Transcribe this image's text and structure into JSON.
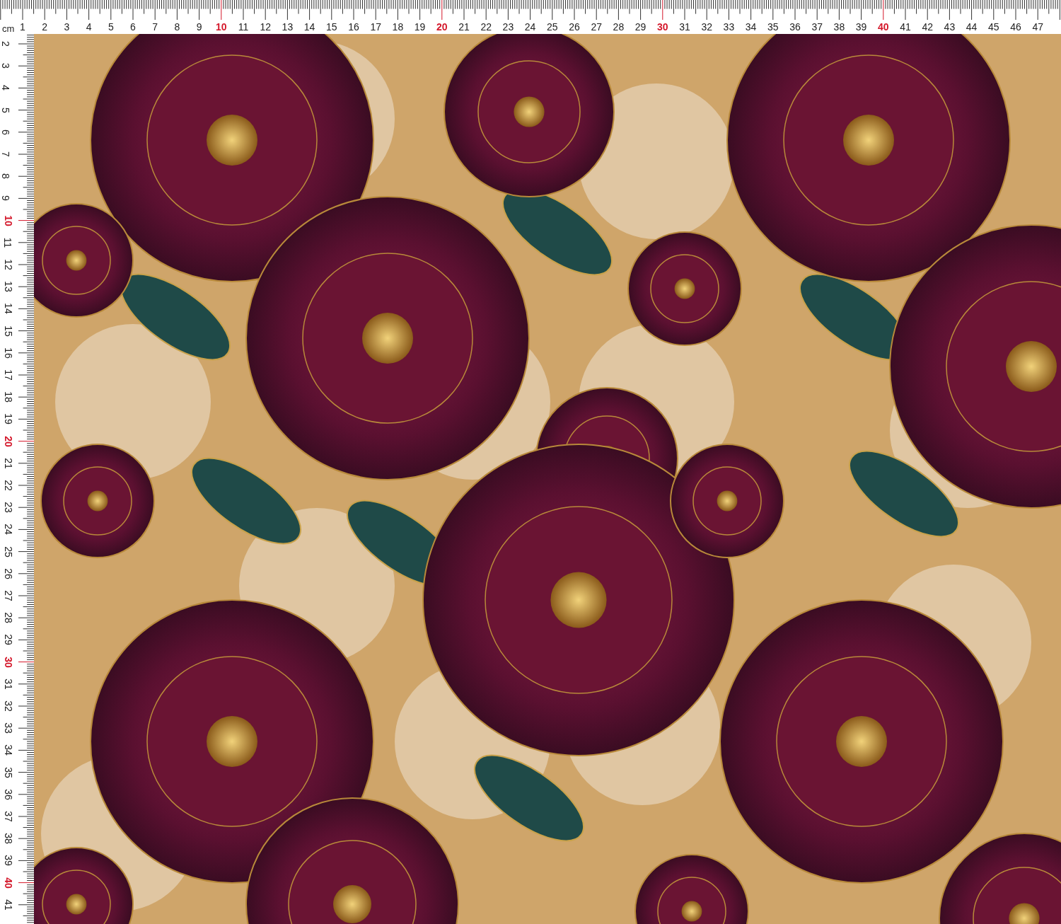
{
  "top_ruler": {
    "unit": "cm",
    "labels": [
      {
        "text": "1",
        "highlighted": false
      },
      {
        "text": "2",
        "highlighted": false
      },
      {
        "text": "3",
        "highlighted": false
      },
      {
        "text": "4",
        "highlighted": false
      },
      {
        "text": "5",
        "highlighted": false
      },
      {
        "text": "6",
        "highlighted": false
      },
      {
        "text": "7",
        "highlighted": false
      },
      {
        "text": "8",
        "highlighted": false
      },
      {
        "text": "9",
        "highlighted": false
      },
      {
        "text": "10",
        "highlighted": true
      },
      {
        "text": "11",
        "highlighted": false
      },
      {
        "text": "12",
        "highlighted": false
      },
      {
        "text": "13",
        "highlighted": false
      },
      {
        "text": "14",
        "highlighted": false
      },
      {
        "text": "15",
        "highlighted": false
      },
      {
        "text": "16",
        "highlighted": false
      },
      {
        "text": "17",
        "highlighted": false
      },
      {
        "text": "18",
        "highlighted": false
      },
      {
        "text": "19",
        "highlighted": false
      },
      {
        "text": "20",
        "highlighted": true
      },
      {
        "text": "21",
        "highlighted": false
      },
      {
        "text": "22",
        "highlighted": false
      },
      {
        "text": "23",
        "highlighted": false
      },
      {
        "text": "24",
        "highlighted": false
      },
      {
        "text": "25",
        "highlighted": false
      },
      {
        "text": "26",
        "highlighted": false
      },
      {
        "text": "27",
        "highlighted": false
      },
      {
        "text": "28",
        "highlighted": false
      },
      {
        "text": "29",
        "highlighted": false
      },
      {
        "text": "30",
        "highlighted": true
      },
      {
        "text": "31",
        "highlighted": false
      },
      {
        "text": "32",
        "highlighted": false
      },
      {
        "text": "33",
        "highlighted": false
      },
      {
        "text": "34",
        "highlighted": false
      },
      {
        "text": "35",
        "highlighted": false
      },
      {
        "text": "36",
        "highlighted": false
      },
      {
        "text": "37",
        "highlighted": false
      },
      {
        "text": "38",
        "highlighted": false
      },
      {
        "text": "39",
        "highlighted": false
      },
      {
        "text": "40",
        "highlighted": true
      },
      {
        "text": "41",
        "highlighted": false
      },
      {
        "text": "42",
        "highlighted": false
      },
      {
        "text": "43",
        "highlighted": false
      },
      {
        "text": "44",
        "highlighted": false
      },
      {
        "text": "45",
        "highlighted": false
      },
      {
        "text": "46",
        "highlighted": false
      },
      {
        "text": "47",
        "highlighted": false
      }
    ]
  },
  "left_ruler": {
    "labels": [
      {
        "text": "2",
        "highlighted": false
      },
      {
        "text": "3",
        "highlighted": false
      },
      {
        "text": "4",
        "highlighted": false
      },
      {
        "text": "5",
        "highlighted": false
      },
      {
        "text": "6",
        "highlighted": false
      },
      {
        "text": "7",
        "highlighted": false
      },
      {
        "text": "8",
        "highlighted": false
      },
      {
        "text": "9",
        "highlighted": false
      },
      {
        "text": "10",
        "highlighted": true
      },
      {
        "text": "11",
        "highlighted": false
      },
      {
        "text": "12",
        "highlighted": false
      },
      {
        "text": "13",
        "highlighted": false
      },
      {
        "text": "14",
        "highlighted": false
      },
      {
        "text": "15",
        "highlighted": false
      },
      {
        "text": "16",
        "highlighted": false
      },
      {
        "text": "17",
        "highlighted": false
      },
      {
        "text": "18",
        "highlighted": false
      },
      {
        "text": "19",
        "highlighted": false
      },
      {
        "text": "20",
        "highlighted": true
      },
      {
        "text": "21",
        "highlighted": false
      },
      {
        "text": "22",
        "highlighted": false
      },
      {
        "text": "23",
        "highlighted": false
      },
      {
        "text": "24",
        "highlighted": false
      },
      {
        "text": "25",
        "highlighted": false
      },
      {
        "text": "26",
        "highlighted": false
      },
      {
        "text": "27",
        "highlighted": false
      },
      {
        "text": "28",
        "highlighted": false
      },
      {
        "text": "29",
        "highlighted": false
      },
      {
        "text": "30",
        "highlighted": true
      },
      {
        "text": "31",
        "highlighted": false
      },
      {
        "text": "32",
        "highlighted": false
      },
      {
        "text": "33",
        "highlighted": false
      },
      {
        "text": "34",
        "highlighted": false
      },
      {
        "text": "35",
        "highlighted": false
      },
      {
        "text": "36",
        "highlighted": false
      },
      {
        "text": "37",
        "highlighted": false
      },
      {
        "text": "38",
        "highlighted": false
      },
      {
        "text": "39",
        "highlighted": false
      },
      {
        "text": "40",
        "highlighted": true
      },
      {
        "text": "41",
        "highlighted": false
      }
    ]
  }
}
